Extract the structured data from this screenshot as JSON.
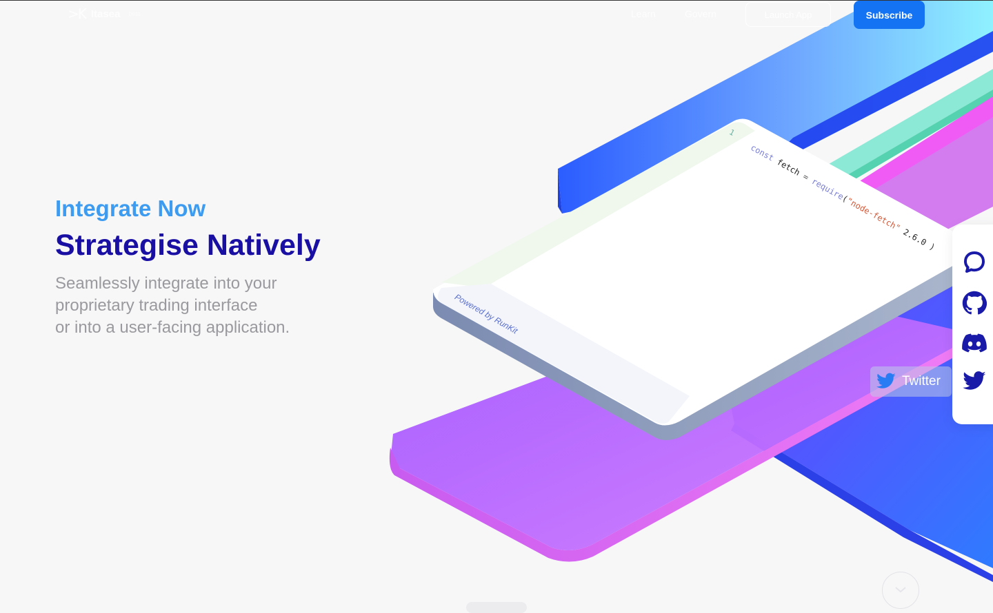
{
  "header": {
    "logo_mark": ">K",
    "logo_text": "Itasea",
    "logo_sup": "beta",
    "nav": [
      {
        "label": "Learn"
      },
      {
        "label": "Govern"
      }
    ],
    "outline_button": "Launch App",
    "subscribe_button": "Subscribe"
  },
  "hero": {
    "eyebrow": "Integrate Now",
    "headline": "Strategise Natively",
    "subtext_lines": [
      "Seamlessly integrate into your",
      "proprietary trading interface",
      "or into a user-facing application."
    ]
  },
  "code_card": {
    "line_number": "1",
    "code": {
      "kw": "const",
      "ident": "fetch",
      "eq": "=",
      "fn": "require",
      "open": "(",
      "str": "\"node-fetch\"",
      "ver": "2.6.0",
      "close": ")"
    },
    "footer": "Powered by RunKit"
  },
  "social": {
    "items": [
      {
        "icon": "chat-icon"
      },
      {
        "icon": "github-icon"
      },
      {
        "icon": "discord-icon"
      },
      {
        "icon": "twitter-icon"
      }
    ],
    "tooltip": "Twitter"
  },
  "colors": {
    "accent_blue": "#1473f2",
    "headline_navy": "#1a0fa3",
    "eyebrow_blue": "#3d9bf0",
    "social_navy": "#1a1aa8"
  }
}
